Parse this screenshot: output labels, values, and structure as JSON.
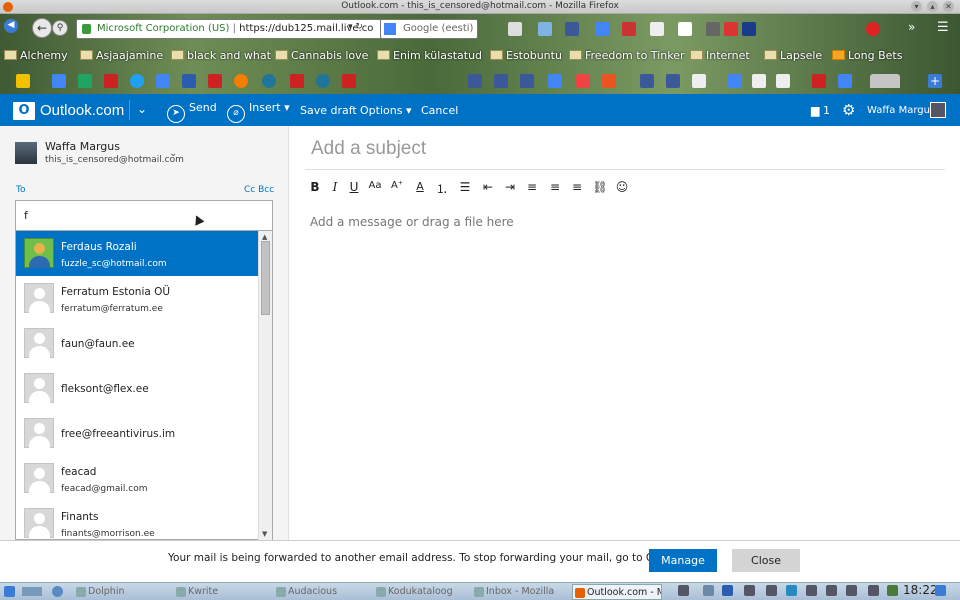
{
  "window": {
    "title": "Outlook.com - this_is_censored@hotmail.com - Mozilla Firefox"
  },
  "browser": {
    "url_org": "Microsoft Corporation (US)",
    "url_text": "https://dub125.mail.live.co",
    "search_placeholder": "Google (eesti)"
  },
  "bookmarks": [
    "Alchemy",
    "Asjaajamine",
    "black and what",
    "Cannabis love",
    "Enim külastatud",
    "Estobuntu",
    "Freedom to Tinker",
    "Internet",
    "Lapsele",
    "Long Bets"
  ],
  "outlook": {
    "logo_letter": "O",
    "brand": "Outlook.com",
    "send": "Send",
    "insert": "Insert",
    "save_draft": "Save draft",
    "options": "Options",
    "cancel": "Cancel",
    "notif_count": "1",
    "user_name": "Waffa Margus"
  },
  "compose": {
    "from_name": "Waffa Margus",
    "from_email": "this_is_censored@hotmail.com",
    "to_label": "To",
    "cc_bcc": "Cc Bcc",
    "to_value": "f",
    "subject_placeholder": "Add a subject",
    "message_placeholder": "Add a message or drag a file here"
  },
  "suggestions": [
    {
      "name": "Ferdaus Rozali",
      "email": "fuzzle_sc@hotmail.com",
      "selected": true
    },
    {
      "name": "Ferratum Estonia OÜ",
      "email": "ferratum@ferratum.ee"
    },
    {
      "single": "faun@faun.ee"
    },
    {
      "single": "fleksont@flex.ee"
    },
    {
      "single": "free@freeantivirus.im"
    },
    {
      "name": "feacad",
      "email": "feacad@gmail.com"
    },
    {
      "name": "Finants",
      "email": "finants@morrison.ee"
    }
  ],
  "notice": {
    "text": "Your mail is being forwarded to another email address. To stop forwarding your mail, go to Options.",
    "manage": "Manage",
    "close": "Close"
  },
  "taskbar": {
    "tasks": [
      "Dolphin",
      "Kwrite",
      "Audacious",
      "Kodukataloog",
      "Inbox - Mozilla",
      "Outlook.com - M"
    ],
    "clock": "18:22"
  },
  "colors": {
    "accent": "#0072c6"
  }
}
